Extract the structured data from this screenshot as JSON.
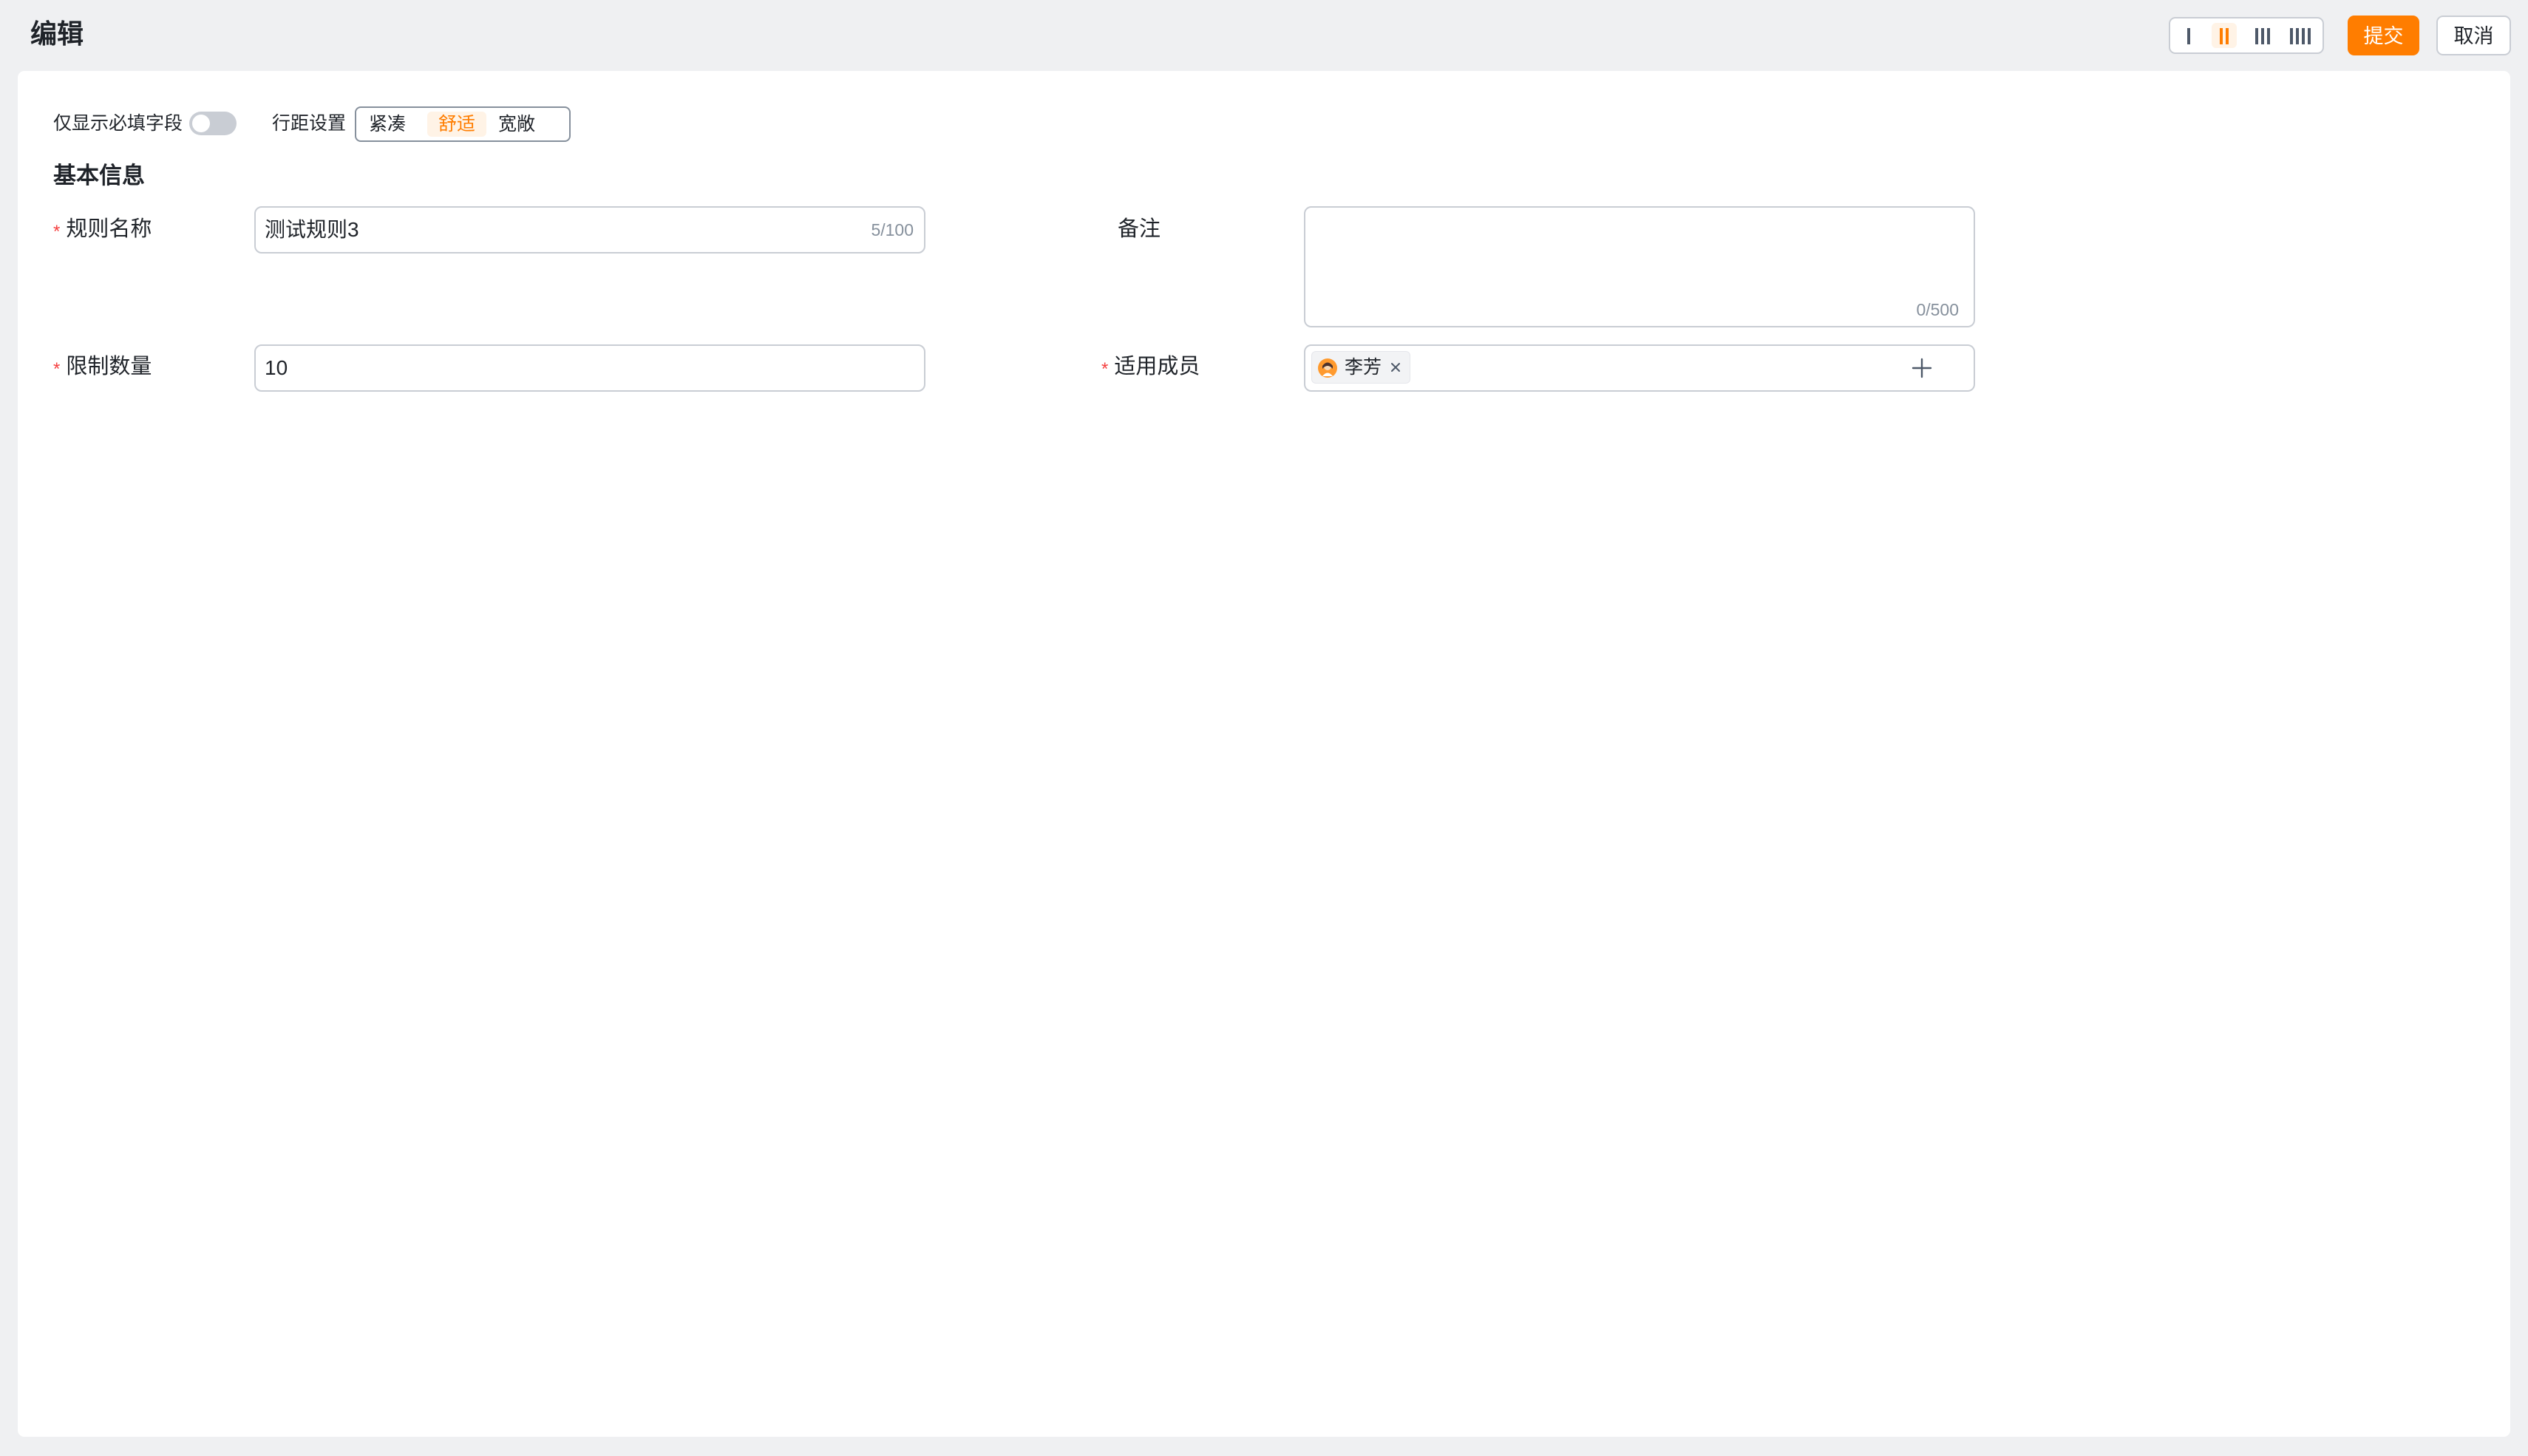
{
  "header": {
    "title": "编辑",
    "layout_options": [
      "one-column-icon",
      "two-column-icon",
      "three-column-icon",
      "four-column-icon"
    ],
    "active_layout_index": 1,
    "submit_label": "提交",
    "cancel_label": "取消"
  },
  "toolbar": {
    "required_only_label": "仅显示必填字段",
    "required_only_enabled": false,
    "row_spacing_label": "行距设置",
    "row_spacing_options": [
      "紧凑",
      "舒适",
      "宽敞"
    ],
    "row_spacing_selected": "舒适"
  },
  "section": {
    "title": "基本信息"
  },
  "fields": {
    "rule_name": {
      "required_mark": "*",
      "label": "规则名称",
      "value": "测试规则3",
      "counter": "5/100"
    },
    "remark": {
      "label": "备注",
      "value": "",
      "counter": "0/500"
    },
    "limit_quantity": {
      "required_mark": "*",
      "label": "限制数量",
      "value": "10"
    },
    "members": {
      "required_mark": "*",
      "label": "适用成员",
      "tags": [
        {
          "name": "李芳",
          "avatar": "avatar-icon"
        }
      ],
      "add_icon": "plus-icon"
    }
  },
  "colors": {
    "accent": "#ff7d00",
    "accent_light": "#fff3e6",
    "required": "#f53f3f",
    "background": "#eff0f2",
    "border": "#c9cdd4"
  }
}
